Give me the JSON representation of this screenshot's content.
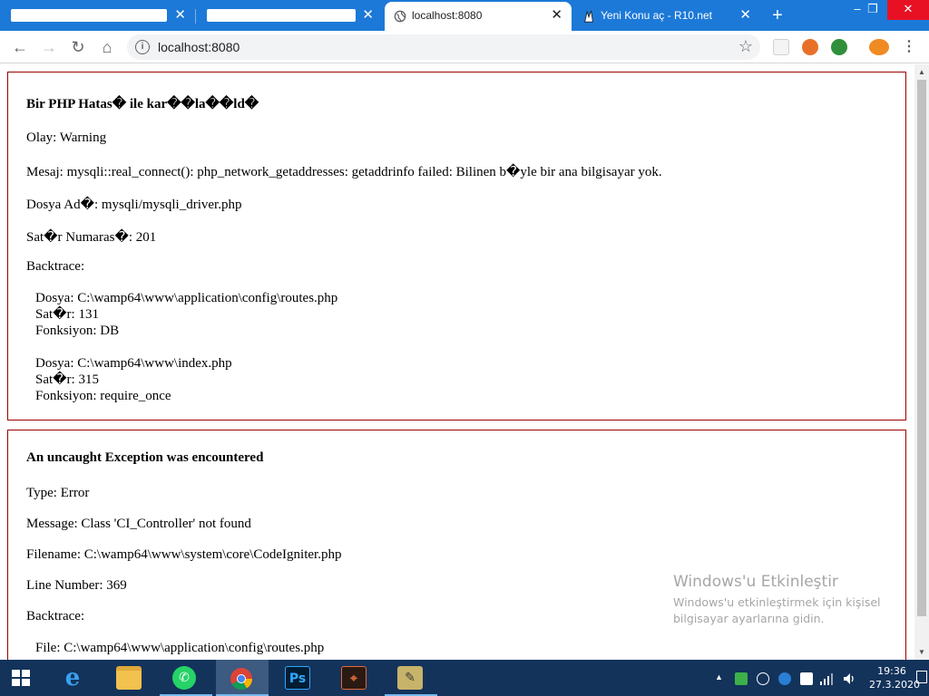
{
  "browser": {
    "tabs": [
      {
        "title": "",
        "redacted": true
      },
      {
        "title": "",
        "redacted": true
      },
      {
        "title": "localhost:8080",
        "active": true
      },
      {
        "title": "Yeni Konu aç - R10.net"
      }
    ],
    "new_tab_label": "+",
    "address": "localhost:8080",
    "window_buttons": {
      "minimize": "–",
      "maximize": "❐",
      "close": "✕"
    }
  },
  "page": {
    "error1": {
      "heading": "Bir PHP Hatas� ile kar��la��ld�",
      "severity": "Olay: Warning",
      "message": "Mesaj: mysqli::real_connect(): php_network_getaddresses: getaddrinfo failed: Bilinen b�yle bir ana bilgisayar yok.",
      "filename": "Dosya Ad�: mysqli/mysqli_driver.php",
      "line": "Sat�r Numaras�: 201",
      "backtrace_label": "Backtrace:",
      "backtrace": [
        {
          "file": "Dosya: C:\\wamp64\\www\\application\\config\\routes.php",
          "line": "Sat�r: 131",
          "function": "Fonksiyon: DB"
        },
        {
          "file": "Dosya: C:\\wamp64\\www\\index.php",
          "line": "Sat�r: 315",
          "function": "Fonksiyon: require_once"
        }
      ]
    },
    "error2": {
      "heading": "An uncaught Exception was encountered",
      "type": "Type: Error",
      "message": "Message: Class 'CI_Controller' not found",
      "filename": "Filename: C:\\wamp64\\www\\system\\core\\CodeIgniter.php",
      "line": "Line Number: 369",
      "backtrace_label": "Backtrace:",
      "backtrace_file": "File: C:\\wamp64\\www\\application\\config\\routes.php"
    }
  },
  "watermark": {
    "title": "Windows'u Etkinleştir",
    "line1": "Windows'u etkinleştirmek için kişisel",
    "line2": "bilgisayar ayarlarına gidin."
  },
  "taskbar": {
    "time": "19:36",
    "date": "27.3.2020",
    "apps": [
      "start",
      "internet-explorer",
      "file-explorer",
      "whatsapp",
      "chrome",
      "photoshop",
      "media-app",
      "tools-app"
    ],
    "ps_label": "Ps"
  },
  "colors": {
    "tabstrip": "#1c79d8",
    "error_border": "#990000",
    "taskbar": "#13335b"
  }
}
